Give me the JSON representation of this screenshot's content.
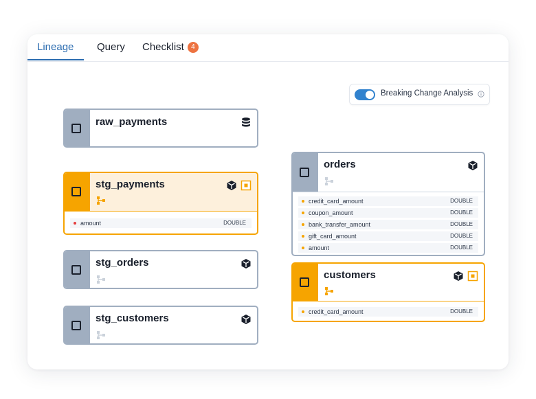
{
  "tabs": [
    {
      "label": "Lineage"
    },
    {
      "label": "Query"
    },
    {
      "label": "Checklist",
      "badge": "4"
    }
  ],
  "toggle": {
    "label": "Breaking Change Analysis",
    "on": true
  },
  "colors": {
    "accent": "#2b6cb0",
    "selected": "#f6a400",
    "node_border": "#a0aec0",
    "badge": "#ed7341",
    "modified_dot": "#e53e3e"
  },
  "nodes": {
    "raw_payments": {
      "title": "raw_payments",
      "icon": "database-icon"
    },
    "stg_payments": {
      "title": "stg_payments",
      "icon": "model-cube-icon",
      "state": "selected",
      "columns": [
        {
          "name": "amount",
          "type": "DOUBLE"
        }
      ]
    },
    "stg_orders": {
      "title": "stg_orders",
      "icon": "model-cube-icon"
    },
    "stg_customers": {
      "title": "stg_customers",
      "icon": "model-cube-icon"
    },
    "orders": {
      "title": "orders",
      "icon": "model-cube-icon",
      "columns": [
        {
          "name": "credit_card_amount",
          "type": "DOUBLE"
        },
        {
          "name": "coupon_amount",
          "type": "DOUBLE"
        },
        {
          "name": "bank_transfer_amount",
          "type": "DOUBLE"
        },
        {
          "name": "gift_card_amount",
          "type": "DOUBLE"
        },
        {
          "name": "amount",
          "type": "DOUBLE"
        }
      ]
    },
    "customers": {
      "title": "customers",
      "icon": "model-cube-icon",
      "state": "selected",
      "columns": [
        {
          "name": "credit_card_amount",
          "type": "DOUBLE"
        }
      ]
    }
  }
}
